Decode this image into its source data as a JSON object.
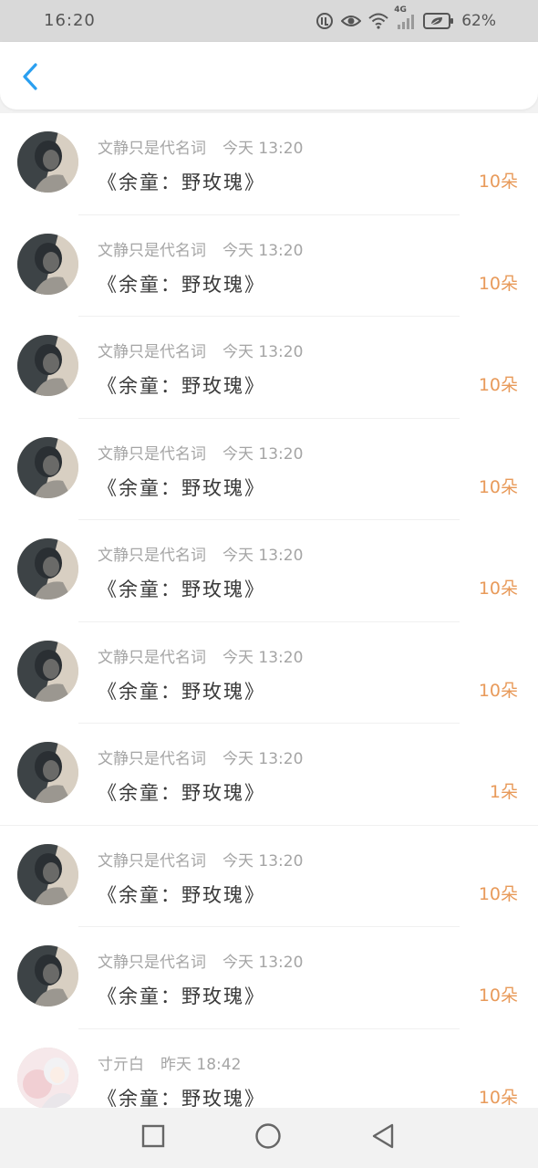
{
  "status_bar": {
    "time": "16:20",
    "network": "4G",
    "battery": "62%"
  },
  "header": {
    "back_icon": "chevron-left-icon",
    "accent_color": "#2a9ff0"
  },
  "items": [
    {
      "name": "文静只是代名词",
      "time": "今天 13:20",
      "title": "《余童：野玫瑰》",
      "count": "10朵",
      "avatar": "dark"
    },
    {
      "name": "文静只是代名词",
      "time": "今天 13:20",
      "title": "《余童：野玫瑰》",
      "count": "10朵",
      "avatar": "dark"
    },
    {
      "name": "文静只是代名词",
      "time": "今天 13:20",
      "title": "《余童：野玫瑰》",
      "count": "10朵",
      "avatar": "dark"
    },
    {
      "name": "文静只是代名词",
      "time": "今天 13:20",
      "title": "《余童：野玫瑰》",
      "count": "10朵",
      "avatar": "dark"
    },
    {
      "name": "文静只是代名词",
      "time": "今天 13:20",
      "title": "《余童：野玫瑰》",
      "count": "10朵",
      "avatar": "dark"
    },
    {
      "name": "文静只是代名词",
      "time": "今天 13:20",
      "title": "《余童：野玫瑰》",
      "count": "10朵",
      "avatar": "dark"
    },
    {
      "name": "文静只是代名词",
      "time": "今天 13:20",
      "title": "《余童：野玫瑰》",
      "count": "1朵",
      "avatar": "dark"
    },
    {
      "name": "文静只是代名词",
      "time": "今天 13:20",
      "title": "《余童：野玫瑰》",
      "count": "10朵",
      "avatar": "dark"
    },
    {
      "name": "文静只是代名词",
      "time": "今天 13:20",
      "title": "《余童：野玫瑰》",
      "count": "10朵",
      "avatar": "dark"
    },
    {
      "name": "寸亓白",
      "time": "昨天 18:42",
      "title": "《余童：野玫瑰》",
      "count": "10朵",
      "avatar": "light"
    }
  ],
  "colors": {
    "count": "#e89a5a",
    "meta": "#a5a5a5",
    "title": "#3a3a3a"
  },
  "nav_bar": {
    "recent_icon": "square-icon",
    "home_icon": "circle-icon",
    "back_icon": "triangle-back-icon"
  }
}
